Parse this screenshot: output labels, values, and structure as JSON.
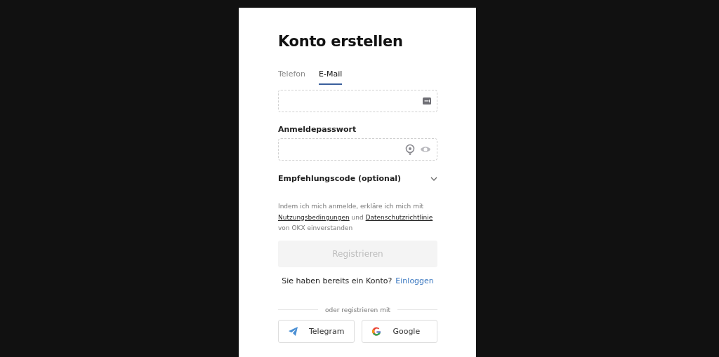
{
  "title": "Konto erstellen",
  "tabs": [
    {
      "label": "Telefon",
      "selected": false
    },
    {
      "label": "E-Mail",
      "selected": true
    }
  ],
  "password": {
    "label": "Anmeldepasswort"
  },
  "referral": {
    "label": "Empfehlungscode (optional)",
    "expanded": false
  },
  "terms": {
    "before": "Indem ich mich anmelde, erkläre ich mich mit",
    "link_1": "Nutzungsbedingungen",
    "middle": "und",
    "link_2": "Datenschutzrichtlinie",
    "after": "von OKX einverstanden"
  },
  "register_button": {
    "label": "Registrieren",
    "disabled": true
  },
  "login_prompt": {
    "text": "Sie haben bereits ein Konto?",
    "link": "Einloggen"
  },
  "divider_text": "oder registrieren mit",
  "social_buttons": [
    {
      "kind": "telegram",
      "label": "Telegram"
    },
    {
      "kind": "google",
      "label": "Google"
    }
  ]
}
